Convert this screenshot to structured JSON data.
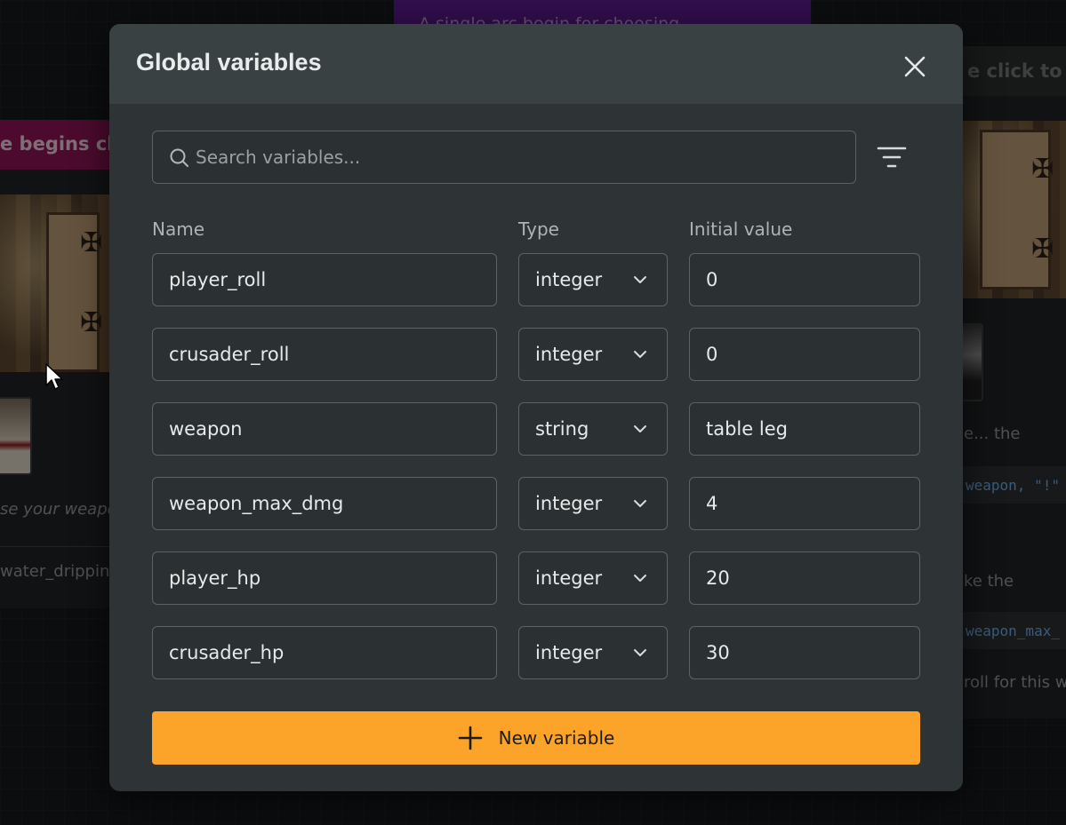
{
  "background": {
    "purple_node_text": "A single arc begin for choosing",
    "left_node_header": "e begins cho",
    "left_node_italic": "se your weapon",
    "left_node_sound": "water_dripping",
    "right_node_header": "e click to ad",
    "right_text_1": "e... the",
    "right_code_1": "weapon, \"!\"",
    "right_text_2": "ke the",
    "right_code_2": "weapon_max_",
    "right_text_3": "roll for this we"
  },
  "modal": {
    "title": "Global variables",
    "close_icon": "close-icon",
    "search": {
      "placeholder": "Search variables...",
      "value": ""
    },
    "filter_icon": "filter-icon",
    "columns": {
      "name": "Name",
      "type": "Type",
      "initial_value": "Initial value"
    },
    "variables": [
      {
        "name": "player_roll",
        "type": "integer",
        "value": "0"
      },
      {
        "name": "crusader_roll",
        "type": "integer",
        "value": "0"
      },
      {
        "name": "weapon",
        "type": "string",
        "value": "table leg"
      },
      {
        "name": "weapon_max_dmg",
        "type": "integer",
        "value": "4"
      },
      {
        "name": "player_hp",
        "type": "integer",
        "value": "20"
      },
      {
        "name": "crusader_hp",
        "type": "integer",
        "value": "30"
      }
    ],
    "new_variable_label": "New variable",
    "accent_color": "#fca32a"
  }
}
